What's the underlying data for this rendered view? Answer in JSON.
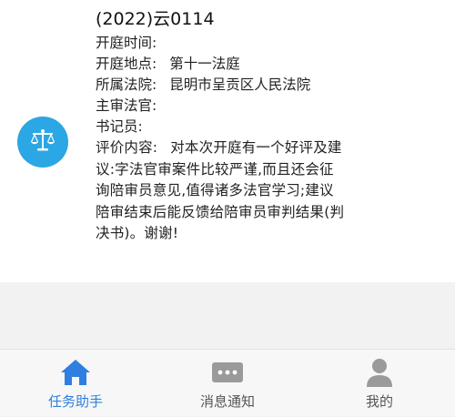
{
  "case": {
    "number": "(2022)云0114"
  },
  "fields": [
    {
      "label": "开庭时间:",
      "value": ""
    },
    {
      "label": "开庭地点:",
      "value": "第十一法庭"
    },
    {
      "label": "所属法院:",
      "value": "昆明市呈贡区人民法院"
    },
    {
      "label": "主审法官:",
      "value": ""
    },
    {
      "label": "书记员:",
      "value": ""
    }
  ],
  "evaluation": {
    "label": "评价内容:",
    "lines": [
      "对本次开庭有一个好评及建",
      "议:字法官审案件比较严谨,而且还会征",
      "询陪审员意见,值得诸多法官学习;建议",
      "陪审结束后能反馈给陪审员审判结果(判",
      "决书)。谢谢!"
    ]
  },
  "avatar": {
    "icon": "scales-of-justice-icon",
    "color": "#2aa7e4"
  },
  "tabbar": {
    "tabs": [
      {
        "label": "任务助手",
        "icon": "home-icon",
        "active": true
      },
      {
        "label": "消息通知",
        "icon": "message-icon",
        "active": false
      },
      {
        "label": "我的",
        "icon": "user-icon",
        "active": false
      }
    ],
    "active_color": "#2f7fe0",
    "inactive_color": "#555555"
  }
}
